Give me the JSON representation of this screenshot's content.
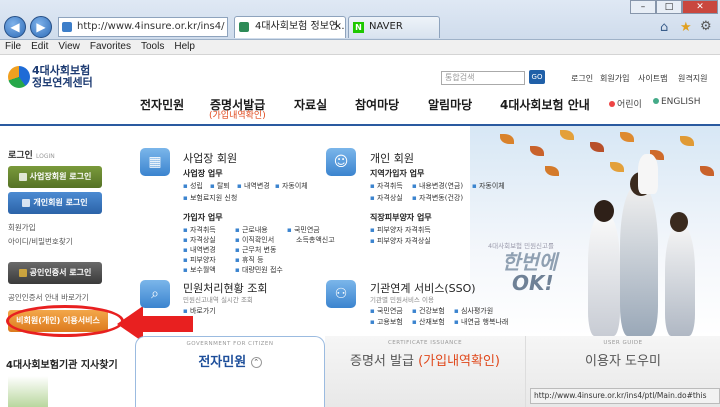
{
  "browser": {
    "address": "http://www.4insure.or.kr/ins4/",
    "tabs": [
      "4대사회보험 정보연...",
      "NAVER"
    ],
    "menu": [
      "File",
      "Edit",
      "View",
      "Favorites",
      "Tools",
      "Help"
    ],
    "status_url": "http://www.4insure.or.kr/ins4/ptl/Main.do#this"
  },
  "header": {
    "logo_line1": "4대사회보험",
    "logo_line2": "정보연계센터",
    "nav": [
      "전자민원",
      "증명서발급",
      "자료실",
      "참여마당",
      "알림마당",
      "4대사회보험 안내"
    ],
    "nav_sub": "(가입내역확인)",
    "search_placeholder": "통합검색",
    "search_btn": "GO",
    "util": [
      "로그인",
      "회원가입",
      "사이트맵",
      "원격지원"
    ],
    "lang": [
      "어린이",
      "ENGLISH"
    ]
  },
  "sidebar": {
    "login_title": "로그인",
    "login_sub": "LOGIN",
    "biz_login": "사업장회원 로그인",
    "personal_login": "개인회원 로그인",
    "join": "회원가입",
    "find": "아이디/비밀번호찾기",
    "cert_login": "공인인증서 로그인",
    "cert_note": "공인인증서 안내 바로가기",
    "guest": "비회원(개인) 이용서비스",
    "agency": "4대사회보험기관 지사찾기"
  },
  "sections": {
    "biz": {
      "title": "사업장 회원",
      "g1_title": "사업장 업무",
      "g1": [
        "성립",
        "탈퇴",
        "내역변경",
        "자동이체",
        "보험료지원 신청"
      ],
      "g2_title": "가입자 업무",
      "g2": [
        "자격취득",
        "근로내용",
        "국민연금",
        "자격상실",
        "이직확인서",
        "소득총액신고",
        "내역변경",
        "근무처 변동",
        "피부양자",
        "휴직 등",
        "보수월액",
        "대량민원 접수"
      ]
    },
    "personal": {
      "title": "개인 회원",
      "g1_title": "지역가입자 업무",
      "g1": [
        "자격취득",
        "내용변경(연금)",
        "자동이체",
        "자격상실",
        "자격변동(건강)"
      ],
      "g2_title": "직장피부양자 업무",
      "g2": [
        "피부양자 자격취득",
        "피부양자 자격상실"
      ]
    },
    "status": {
      "title": "민원처리현황 조회",
      "caption": "민원신고내역 실시간 조회",
      "link": "바로가기"
    },
    "sso": {
      "title": "기관연계 서비스(SSO)",
      "caption": "기관별 민원서비스 이용",
      "items": [
        "국민연금",
        "건강보험",
        "심사평가원",
        "고용보험",
        "산재보험",
        "내연금 행복나래"
      ]
    }
  },
  "slogan": {
    "caption": "4대사회보험 민원신고를",
    "line1": "한번에",
    "line2": "OK!"
  },
  "bottom_tabs": [
    {
      "cap": "GOVERNMENT FOR CITIZEN",
      "label": "전자민원"
    },
    {
      "cap": "CERTIFICATE ISSUANCE",
      "label": "증명서 발급",
      "hl": "(가입내역확인)"
    },
    {
      "cap": "USER GUIDE",
      "label": "이용자 도우미"
    }
  ]
}
